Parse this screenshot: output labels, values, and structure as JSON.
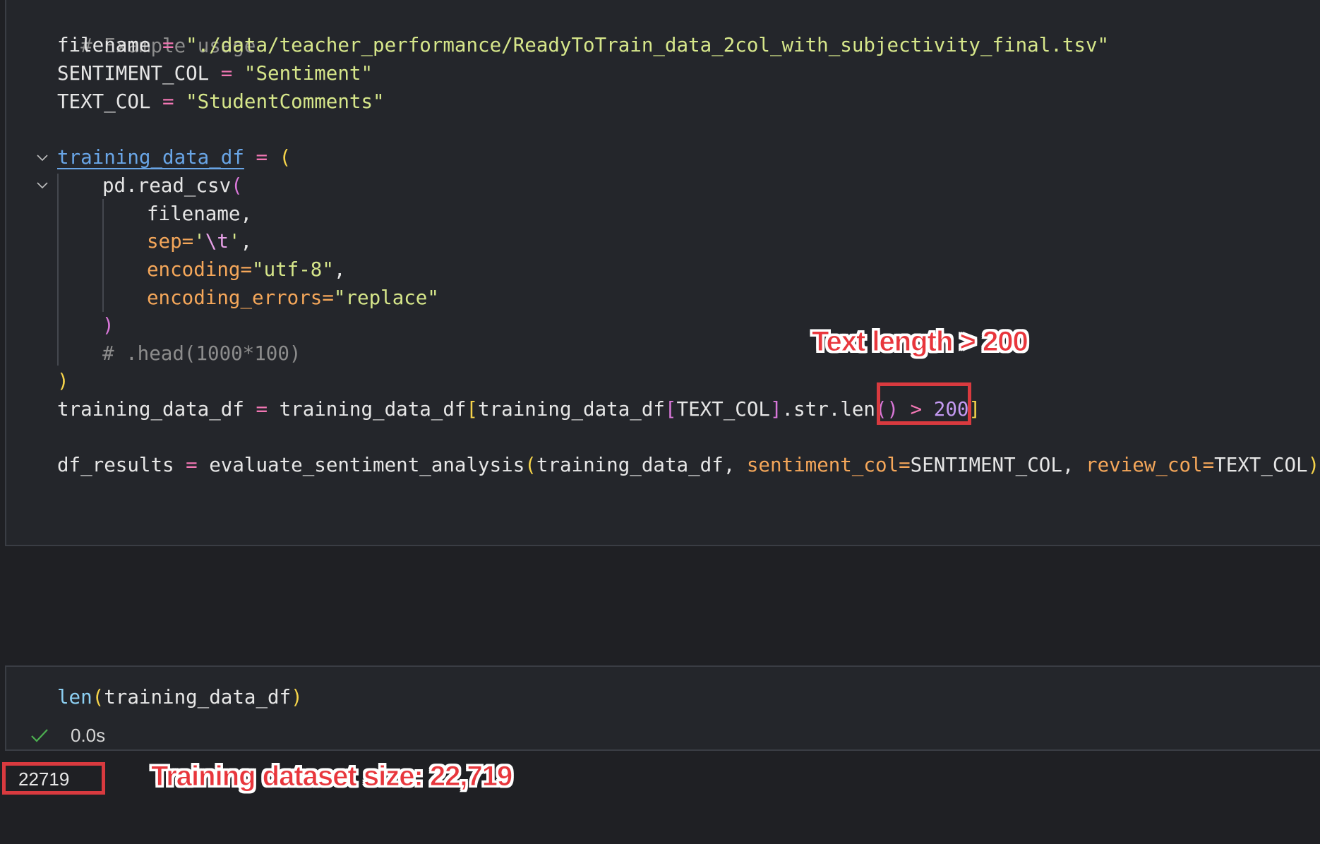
{
  "code_cell": {
    "lines": {
      "l1": {
        "comment": "# Example usage"
      },
      "l2": {
        "var": "filename",
        "op": " = ",
        "str": "\"./data/teacher_performance/ReadyToTrain_data_2col_with_subjectivity_final.tsv\""
      },
      "l3": {
        "var": "SENTIMENT_COL",
        "op": " = ",
        "str": "\"Sentiment\""
      },
      "l4": {
        "var": "TEXT_COL",
        "op": " = ",
        "str": "\"StudentComments\""
      },
      "l5": {
        "var": "training_data_df",
        "op": " = ",
        "paren": "("
      },
      "l6": {
        "call": "pd.read_csv",
        "paren": "("
      },
      "l7": {
        "arg": "filename,"
      },
      "l8": {
        "param": "sep=",
        "str_open": "'",
        "esc": "\\t",
        "str_close": "'",
        "comma": ","
      },
      "l9": {
        "param": "encoding=",
        "str": "\"utf-8\"",
        "comma": ","
      },
      "l10": {
        "param": "encoding_errors=",
        "str": "\"replace\""
      },
      "l11": {
        "paren": ")"
      },
      "l12": {
        "comment": "# .head(1000*100)"
      },
      "l13": {
        "paren": ")"
      },
      "l14": {
        "var": "training_data_df",
        "op": " = ",
        "p1": "training_data_df",
        "b1": "[",
        "p2": "training_data_df",
        "b2": "[",
        "p3": "TEXT_COL",
        "b3": "]",
        "p4": ".str.len",
        "b4": "()",
        "op2": " > ",
        "num": "200",
        "b5": "]"
      },
      "l16": {
        "var": "df_results",
        "op": " = ",
        "fn": "evaluate_sentiment_analysis",
        "b1": "(",
        "a1": "training_data_df, ",
        "k1": "sentiment_col=",
        "v1": "SENTIMENT_COL",
        "sep": ", ",
        "k2": "review_col=",
        "v2": "TEXT_COL",
        "b2": ")"
      }
    }
  },
  "len_cell": {
    "fn": "len",
    "open": "(",
    "arg": "training_data_df",
    "close": ")",
    "exec_time": "0.0s",
    "status_icon": "check-icon"
  },
  "output": {
    "value": "22719"
  },
  "annotations": {
    "text_length_label": "Text length > 200",
    "dataset_size_label": "Training dataset size: 22,719"
  },
  "colors": {
    "background": "#1f2024",
    "cell_background": "#24262b",
    "annotation_red": "#d93a3f",
    "check_green": "#4caf50"
  }
}
